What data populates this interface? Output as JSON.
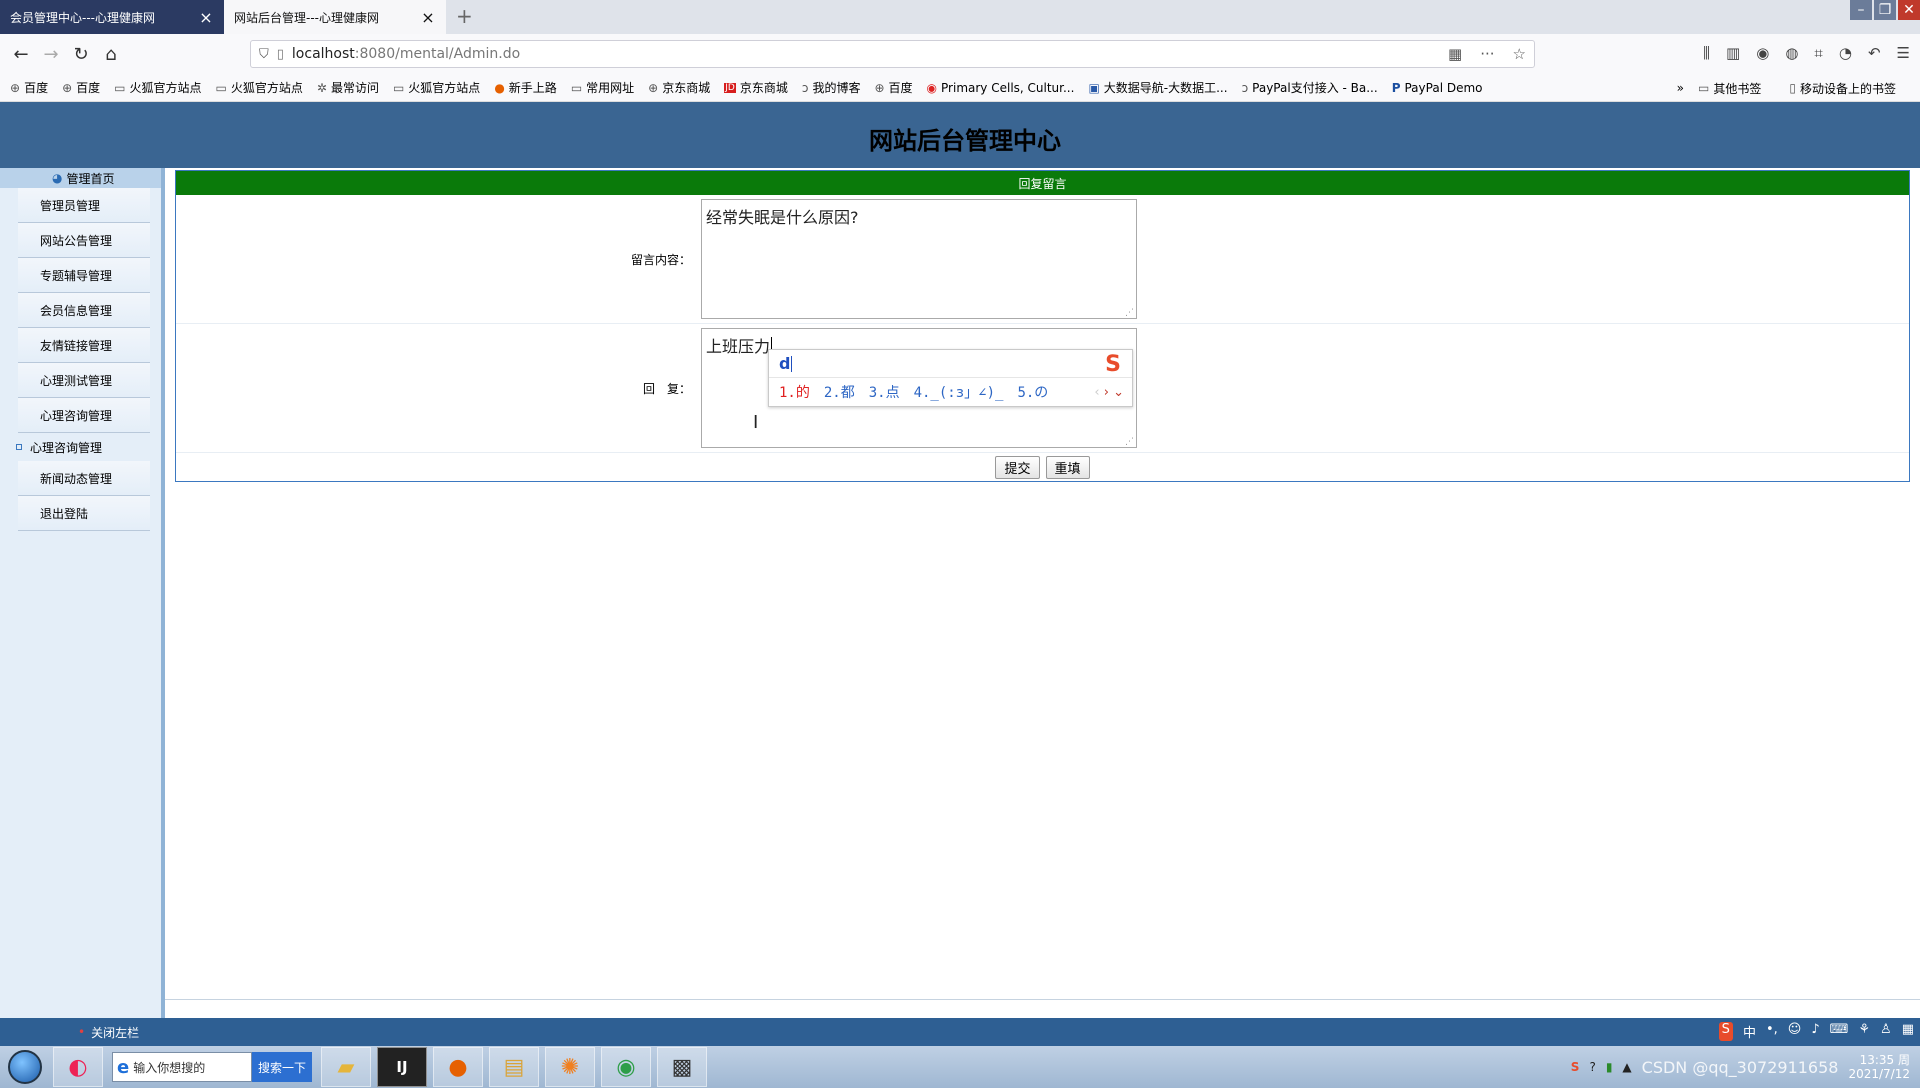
{
  "browser": {
    "tabs": [
      {
        "label": "会员管理中心---心理健康网",
        "active": false
      },
      {
        "label": "网站后台管理---心理健康网",
        "active": true
      }
    ],
    "new_tab": "+",
    "url_host": "localhost",
    "url_rest": ":8080/mental/Admin.do",
    "bookmarks": [
      {
        "icon": "globe-icon",
        "label": "百度"
      },
      {
        "icon": "globe-icon",
        "label": "百度"
      },
      {
        "icon": "folder-icon",
        "label": "火狐官方站点"
      },
      {
        "icon": "folder-icon",
        "label": "火狐官方站点"
      },
      {
        "icon": "gear-icon",
        "label": "最常访问"
      },
      {
        "icon": "folder-icon",
        "label": "火狐官方站点"
      },
      {
        "icon": "firefox-icon",
        "label": "新手上路"
      },
      {
        "icon": "folder-icon",
        "label": "常用网址"
      },
      {
        "icon": "globe-icon",
        "label": "京东商城"
      },
      {
        "icon": "jd-icon",
        "label": "京东商城"
      },
      {
        "icon": "blog-icon",
        "label": "我的博客"
      },
      {
        "icon": "globe-icon",
        "label": "百度"
      },
      {
        "icon": "cells-icon",
        "label": "Primary Cells, Cultur..."
      },
      {
        "icon": "bigdata-icon",
        "label": "大数据导航-大数据工..."
      },
      {
        "icon": "paypal-icon",
        "label": "PayPal支付接入 - Ba..."
      },
      {
        "icon": "paypal-icon",
        "label": "PayPal Demo"
      }
    ],
    "bookmarks_right": [
      "其他书签",
      "移动设备上的书签"
    ]
  },
  "page": {
    "title": "网站后台管理中心",
    "sidebar": {
      "home": "管理首页",
      "items": [
        {
          "label": "管理员管理"
        },
        {
          "label": "网站公告管理"
        },
        {
          "label": "专题辅导管理"
        },
        {
          "label": "会员信息管理"
        },
        {
          "label": "友情链接管理"
        },
        {
          "label": "心理测试管理"
        },
        {
          "label": "心理咨询管理"
        },
        {
          "label": "心理咨询管理"
        },
        {
          "label": "新闻动态管理"
        },
        {
          "label": "退出登陆"
        }
      ]
    },
    "form": {
      "heading": "回复留言",
      "message_label": "留言内容：",
      "message_value": "经常失眠是什么原因?",
      "reply_label": "回　复：",
      "reply_value": "上班压力",
      "submit_label": "提交",
      "reset_label": "重填"
    },
    "ime": {
      "composition": "d",
      "candidates": [
        "1.的",
        "2.都",
        "3.点",
        "4._(:з」∠)_",
        "5.の"
      ],
      "logo": "S"
    },
    "close_sidebar": "关闭左栏"
  },
  "taskbar": {
    "search_placeholder": "输入你想搜的",
    "search_button": "搜索一下",
    "ime_indicator": "中",
    "clock_time": "13:35 周",
    "clock_date": "2021/7/12",
    "watermark": "CSDN @qq_3072911658"
  }
}
